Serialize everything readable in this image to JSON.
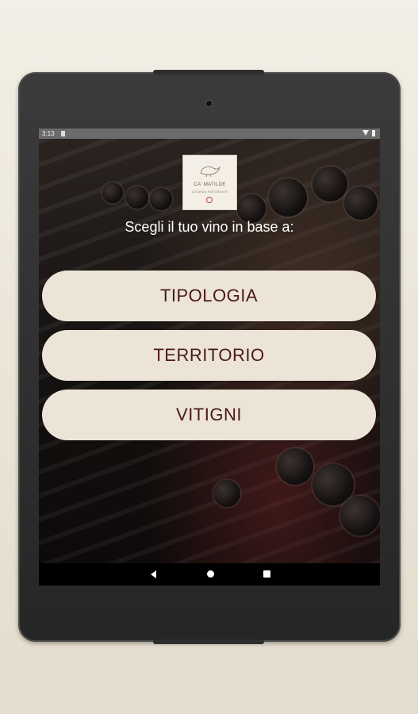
{
  "status_bar": {
    "time": "3:13",
    "icons": [
      "notification-icon",
      "wifi-icon",
      "battery-icon"
    ]
  },
  "logo": {
    "name": "CA' MATILDE",
    "tagline": "LOCANDA RISTORANTE"
  },
  "main": {
    "prompt": "Scegli il tuo vino in base a:",
    "choices": [
      {
        "label": "TIPOLOGIA"
      },
      {
        "label": "TERRITORIO"
      },
      {
        "label": "VITIGNI"
      }
    ]
  },
  "nav_bar": {
    "icons": [
      "back-icon",
      "home-icon",
      "recents-icon"
    ]
  },
  "colors": {
    "button_bg": "#ece4d6",
    "button_text": "#4a1a1a",
    "prompt_text": "#ffffff",
    "page_bg": "#ebe5d8"
  }
}
